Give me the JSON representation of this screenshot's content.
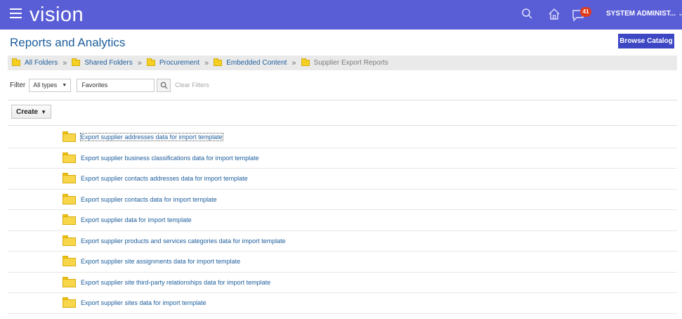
{
  "app": {
    "brand": "vision",
    "notification_count": "41",
    "user_label": "SYSTEM ADMINIST...",
    "topbar_color": "#5a5ed6"
  },
  "header": {
    "title": "Reports and Analytics",
    "browse_catalog_label": "Browse Catalog"
  },
  "breadcrumb": [
    {
      "label": "All Folders"
    },
    {
      "label": "Shared Folders"
    },
    {
      "label": "Procurement"
    },
    {
      "label": "Embedded Content"
    },
    {
      "label": "Supplier Export Reports"
    }
  ],
  "filter": {
    "label": "Filter",
    "type_value": "All types",
    "search_value": "Favorites",
    "clear_label": "Clear Filters"
  },
  "create_label": "Create",
  "reports": [
    {
      "name": "Export supplier addresses data for import template"
    },
    {
      "name": "Export supplier business classifications data for import template"
    },
    {
      "name": "Export supplier contacts addresses data for import template"
    },
    {
      "name": "Export supplier contacts data for import template"
    },
    {
      "name": "Export supplier data for import template"
    },
    {
      "name": "Export supplier products and services categories data for import template"
    },
    {
      "name": "Export supplier site assignments data for import template"
    },
    {
      "name": "Export supplier site third-party relationships data for import template"
    },
    {
      "name": "Export supplier sites data for import template"
    }
  ]
}
